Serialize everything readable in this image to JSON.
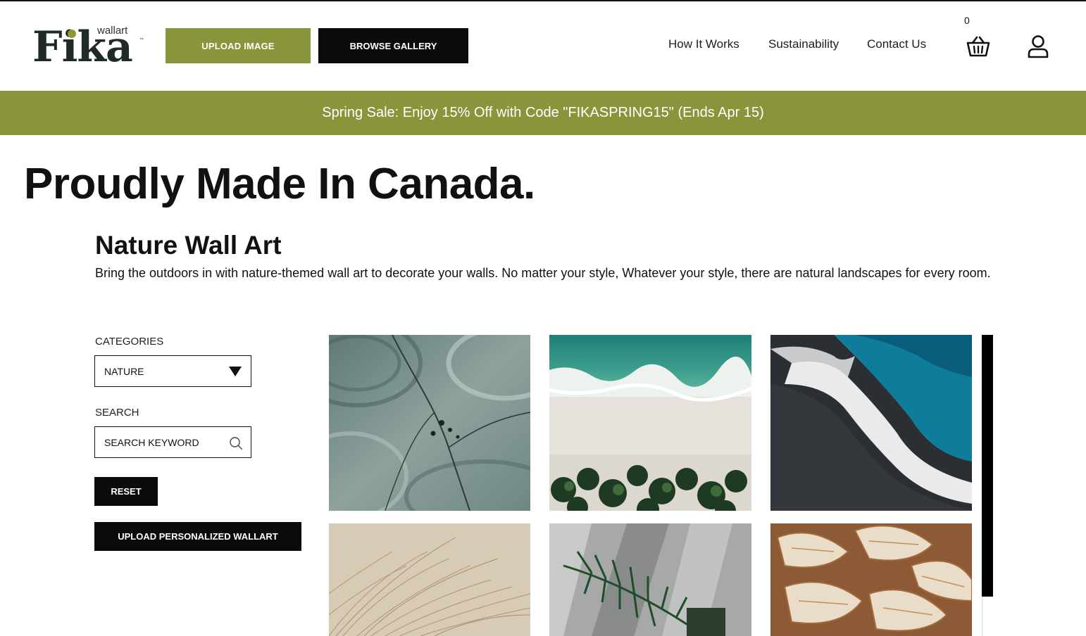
{
  "brand": {
    "logo_main": "Fika",
    "logo_sub": "wallart",
    "logo_tm": "™",
    "accent_color": "#8a943a"
  },
  "header": {
    "upload_label": "UPLOAD IMAGE",
    "browse_label": "BROWSE GALLERY",
    "nav": [
      "How It Works",
      "Sustainability",
      "Contact Us"
    ],
    "cart_count": "0",
    "icons": [
      "basket-icon",
      "user-icon"
    ]
  },
  "promo": {
    "text": "Spring Sale: Enjoy 15% Off with Code \"FIKASPRING15\" (Ends Apr 15)"
  },
  "hero": {
    "title": "Proudly Made In Canada."
  },
  "section": {
    "title": "Nature Wall Art",
    "description": "Bring the outdoors in with nature-themed wall art to decorate your walls. No matter your style, Whatever your style, there are natural landscapes for every room."
  },
  "filters": {
    "categories_label": "CATEGORIES",
    "category_selected": "NATURE",
    "search_label": "SEARCH",
    "search_placeholder": "SEARCH KEYWORD",
    "reset_label": "RESET",
    "personalized_label": "UPLOAD PERSONALIZED WALLART"
  },
  "gallery": {
    "items": [
      "aerial-riverbed-image",
      "beach-palms-image",
      "black-sand-wave-image",
      "dry-grass-image",
      "palm-leaf-shadow-image",
      "seashells-image"
    ]
  }
}
